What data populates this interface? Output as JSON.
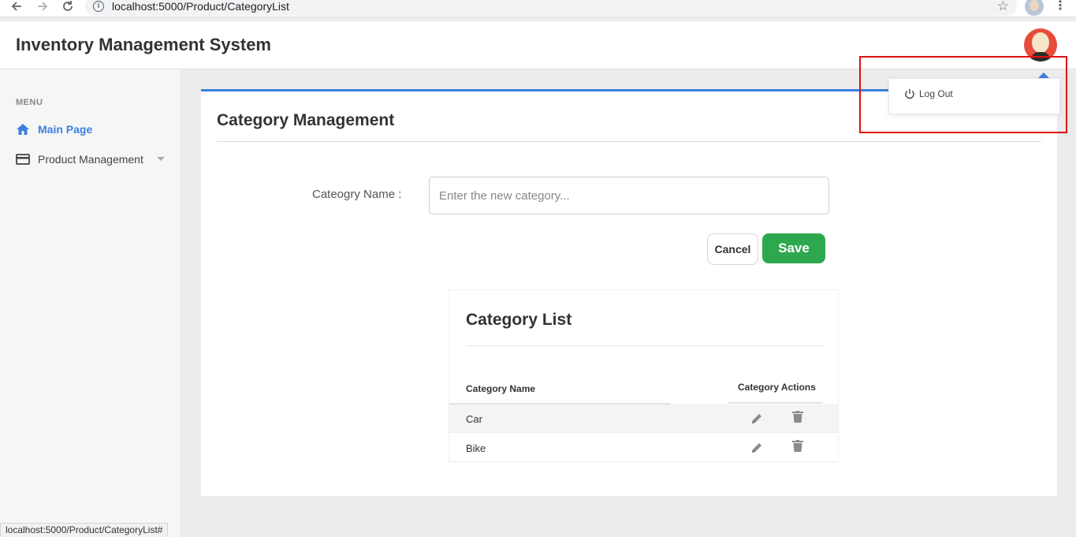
{
  "browser": {
    "url": "localhost:5000/Product/CategoryList",
    "status_url": "localhost:5000/Product/CategoryList#"
  },
  "header": {
    "title": "Inventory Management System"
  },
  "sidebar": {
    "menu_label": "MENU",
    "items": [
      {
        "label": "Main Page",
        "icon": "home-icon",
        "active": true
      },
      {
        "label": "Product Management",
        "icon": "card-icon",
        "active": false
      }
    ]
  },
  "page": {
    "title": "Category Management",
    "field_label": "Cateogry Name :",
    "input_placeholder": "Enter the new category...",
    "input_value": "",
    "cancel_label": "Cancel",
    "save_label": "Save"
  },
  "category_list": {
    "title": "Category List",
    "col_name": "Category Name",
    "col_actions": "Category Actions",
    "rows": [
      {
        "name": "Car"
      },
      {
        "name": "Bike"
      }
    ]
  },
  "user_menu": {
    "logout_label": "Log Out"
  },
  "colors": {
    "accent": "#3c7fe0",
    "save": "#2ea84f",
    "avatar": "#e74c3c",
    "highlight": "#e01010"
  }
}
